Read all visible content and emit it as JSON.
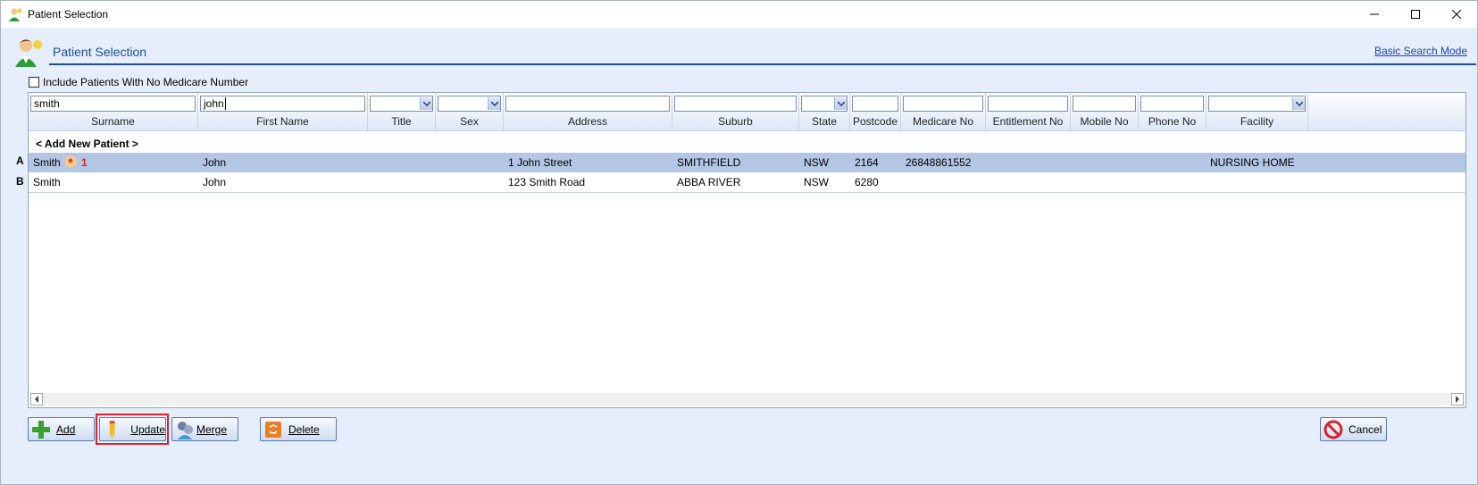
{
  "window": {
    "title": "Patient Selection"
  },
  "header": {
    "title": "Patient Selection",
    "basic_search_link": "Basic Search Mode"
  },
  "options": {
    "include_no_medicare_label": "Include Patients With No Medicare Number",
    "include_no_medicare_checked": false
  },
  "filters": {
    "surname": {
      "label": "Surname",
      "value": "smith"
    },
    "first_name": {
      "label": "First Name",
      "value": "john"
    },
    "title": {
      "label": "Title",
      "value": ""
    },
    "sex": {
      "label": "Sex",
      "value": ""
    },
    "address": {
      "label": "Address",
      "value": ""
    },
    "suburb": {
      "label": "Suburb",
      "value": ""
    },
    "state": {
      "label": "State",
      "value": ""
    },
    "postcode": {
      "label": "Postcode",
      "value": ""
    },
    "medicare_no": {
      "label": "Medicare No",
      "value": ""
    },
    "entitlement_no": {
      "label": "Entitlement No",
      "value": ""
    },
    "mobile_no": {
      "label": "Mobile No",
      "value": ""
    },
    "phone_no": {
      "label": "Phone No",
      "value": ""
    },
    "facility": {
      "label": "Facility",
      "value": ""
    }
  },
  "grid": {
    "add_new_label": "< Add New Patient >",
    "rows": [
      {
        "key": "A",
        "surname": "Smith",
        "badge": "1",
        "first_name": "John",
        "address": "1 John Street",
        "suburb": "SMITHFIELD",
        "state": "NSW",
        "postcode": "2164",
        "medicare_no": "26848861552",
        "facility": "NURSING HOME",
        "selected": true
      },
      {
        "key": "B",
        "surname": "Smith",
        "badge": "",
        "first_name": "John",
        "address": "123 Smith Road",
        "suburb": "ABBA RIVER",
        "state": "NSW",
        "postcode": "6280",
        "medicare_no": "",
        "facility": "",
        "selected": false
      }
    ]
  },
  "buttons": {
    "add": {
      "label": "Add",
      "icon": "plus-icon"
    },
    "update": {
      "label": "Update",
      "icon": "pencil-icon"
    },
    "merge": {
      "label": "Merge",
      "icon": "merge-users-icon"
    },
    "delete": {
      "label": "Delete",
      "icon": "recycle-bin-icon"
    },
    "cancel": {
      "label": "Cancel",
      "icon": "no-entry-icon"
    }
  },
  "colors": {
    "accent": "#1f4c94",
    "selected_row": "#b3c6e3",
    "highlight": "#e0222c",
    "link": "#1b46b8"
  }
}
